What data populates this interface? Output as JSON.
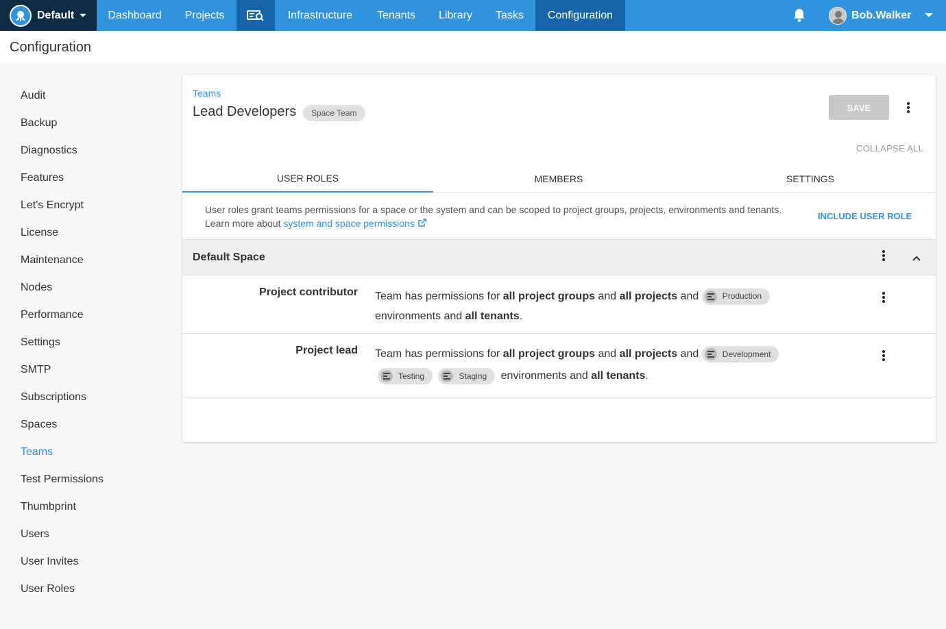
{
  "topnav": {
    "space_name": "Default",
    "items": [
      "Dashboard",
      "Projects",
      "Infrastructure",
      "Tenants",
      "Library",
      "Tasks",
      "Configuration"
    ],
    "user_name": "Bob.Walker"
  },
  "page_title": "Configuration",
  "sidebar": {
    "items": [
      "Audit",
      "Backup",
      "Diagnostics",
      "Features",
      "Let's Encrypt",
      "License",
      "Maintenance",
      "Nodes",
      "Performance",
      "Settings",
      "SMTP",
      "Subscriptions",
      "Spaces",
      "Teams",
      "Test Permissions",
      "Thumbprint",
      "Users",
      "User Invites",
      "User Roles"
    ],
    "active": "Teams"
  },
  "card": {
    "breadcrumb": "Teams",
    "title": "Lead Developers",
    "chip": "Space Team",
    "save_label": "SAVE",
    "collapse_all": "COLLAPSE ALL",
    "tabs": [
      "USER ROLES",
      "MEMBERS",
      "SETTINGS"
    ],
    "info_line1": "User roles grant teams permissions for a space or the system and can be scoped to project groups, projects, environments and tenants.",
    "info_line2_prefix": "Learn more about",
    "info_link": "system and space permissions",
    "include_label": "INCLUDE USER ROLE",
    "space_section": "Default Space",
    "roles": [
      {
        "name": "Project contributor",
        "t1": "Team has permissions for",
        "b1": "all project groups",
        "t2": "and",
        "b2": "all projects",
        "t3": "and",
        "envs": [
          "Production"
        ],
        "t4": "environments and",
        "b3": "all tenants",
        "t5": "."
      },
      {
        "name": "Project lead",
        "t1": "Team has permissions for",
        "b1": "all project groups",
        "t2": "and",
        "b2": "all projects",
        "t3": "and",
        "envs": [
          "Development",
          "Testing",
          "Staging"
        ],
        "t4": "environments and",
        "b3": "all tenants",
        "t5": "."
      }
    ]
  },
  "colors": {
    "nav_blue": "#2f93e0",
    "nav_dark": "#0d2b45",
    "nav_active": "#1765a8",
    "link_blue": "#2f93e0"
  }
}
